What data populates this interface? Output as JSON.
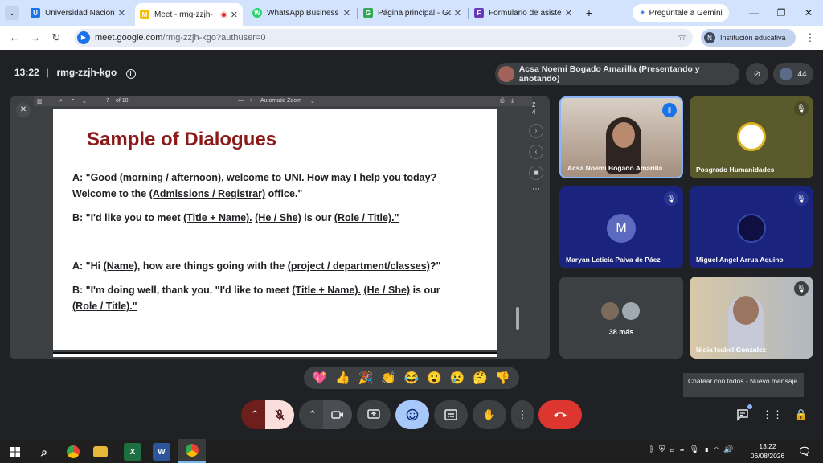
{
  "tabs": [
    {
      "title": "Universidad Nacional",
      "favicon": "U",
      "color": "#1a73e8"
    },
    {
      "title": "Meet - rmg-zzjh-",
      "favicon": "M",
      "color": "#fbbc04",
      "active": true
    },
    {
      "title": "WhatsApp Business",
      "favicon": "W",
      "color": "#25d366"
    },
    {
      "title": "Página principal - Go",
      "favicon": "G",
      "color": "#34a853"
    },
    {
      "title": "Formulario de asister",
      "favicon": "F",
      "color": "#673ab7"
    }
  ],
  "gemini_label": "Pregúntale a Gemini",
  "address": {
    "host": "meet.google.com",
    "path": "/rmg-zzjh-kgo?authuser=0"
  },
  "profile": {
    "initial": "N",
    "label": "Institución educativa"
  },
  "meeting": {
    "time": "13:22",
    "code": "rmg-zzjh-kgo",
    "presenter_chip": "Acsa Noemi Bogado Amarilla (Presentando y anotando)",
    "participant_count": "44"
  },
  "pdf": {
    "page_num": "7",
    "page_total": "of 10",
    "zoom": "Automatic Zoom",
    "rail_page": "2",
    "rail_sub": "4"
  },
  "slide": {
    "title": "Sample of Dialogues",
    "a1_pre": "A: \"Good ",
    "a1_u1": "(morning / afternoon),",
    "a1_post": " welcome to UNI. How may I help you today?",
    "a2_pre": "Welcome to the ",
    "a2_u1": "(Admissions / Registrar)",
    "a2_post": " office.\"",
    "b1_pre": "B: \"I'd like you to meet ",
    "b1_u1": "(Title + Name).",
    "b1_mid": " ",
    "b1_u2": "(He / She)",
    "b1_mid2": " is our ",
    "b1_u3": "(Role / Title).\"",
    "a3_pre": "A: \"Hi ",
    "a3_u1": "(Name),",
    "a3_mid": " how are things going with the ",
    "a3_u2": "(project / department/classes)",
    "a3_post": "?\"",
    "b2_pre": "B: \"I'm doing well, thank you. \"I'd like to meet ",
    "b2_u1": "(Title + Name).",
    "b2_mid": " ",
    "b2_u2": "(He / She)",
    "b2_mid2": " is our",
    "b3_u1": "(Role / Title).\""
  },
  "participants": [
    {
      "name": "Acsa Noemi Bogado Amarilla",
      "bg": "#9a7d6a"
    },
    {
      "name": "Posgrado Humanidades",
      "bg": "#5a5a2c"
    },
    {
      "name": "Maryan Leticia Paiva de Páez",
      "initial": "M",
      "bg": "#1a237e"
    },
    {
      "name": "Miguel Angel Arrua Aquino",
      "bg": "#1a237e"
    },
    {
      "name": "38 más",
      "bg": "#3c4043"
    },
    {
      "name": "Nidia Isabel González",
      "bg": "#b8b0a0"
    }
  ],
  "reactions": [
    "💖",
    "👍",
    "🎉",
    "👏",
    "😂",
    "😮",
    "😢",
    "🤔",
    "👎"
  ],
  "tooltip": "Chatear con todos - Nuevo mensaje",
  "clock": {
    "time": "13:22",
    "date": "06/08/2026"
  }
}
